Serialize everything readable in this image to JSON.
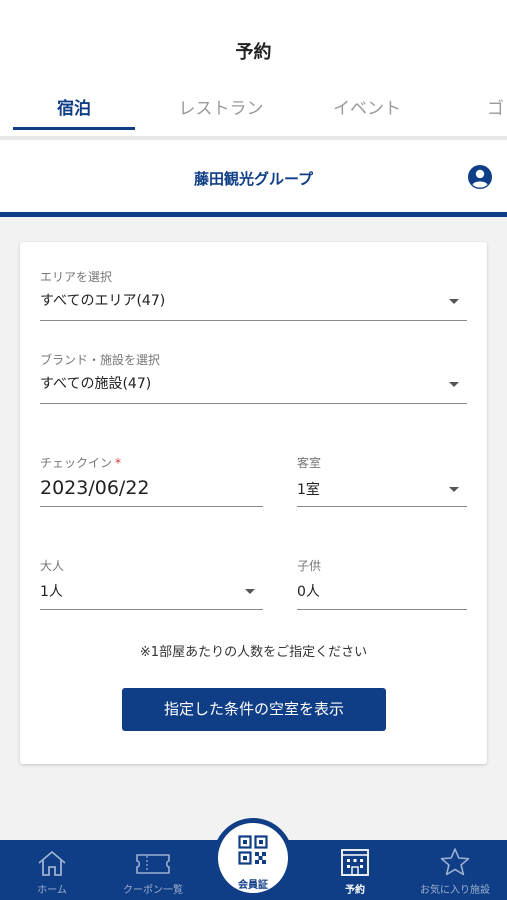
{
  "header": {
    "title": "予約",
    "tabs": [
      "宿泊",
      "レストラン",
      "イベント",
      "ゴ"
    ]
  },
  "brand": {
    "name": "藤田観光グループ",
    "account_icon": "account-circle-icon"
  },
  "form": {
    "area": {
      "label": "エリアを選択",
      "value": "すべてのエリア(47)"
    },
    "facility": {
      "label": "ブランド・施設を選択",
      "value": "すべての施設(47)"
    },
    "checkin": {
      "label": "チェックイン",
      "required_mark": "*",
      "value": "2023/06/22"
    },
    "rooms": {
      "label": "客室",
      "value": "1室"
    },
    "adults": {
      "label": "大人",
      "value": "1人"
    },
    "children": {
      "label": "子供",
      "value": "0人"
    },
    "note": "※1部屋あたりの人数をご指定ください",
    "submit_label": "指定した条件の空室を表示"
  },
  "bottom_nav": {
    "home": "ホーム",
    "coupons": "クーポン一覧",
    "member": "会員証",
    "reserve": "予約",
    "favorites": "お気に入り施設"
  },
  "colors": {
    "brand": "#0f3e86",
    "required": "#d23a3a"
  }
}
